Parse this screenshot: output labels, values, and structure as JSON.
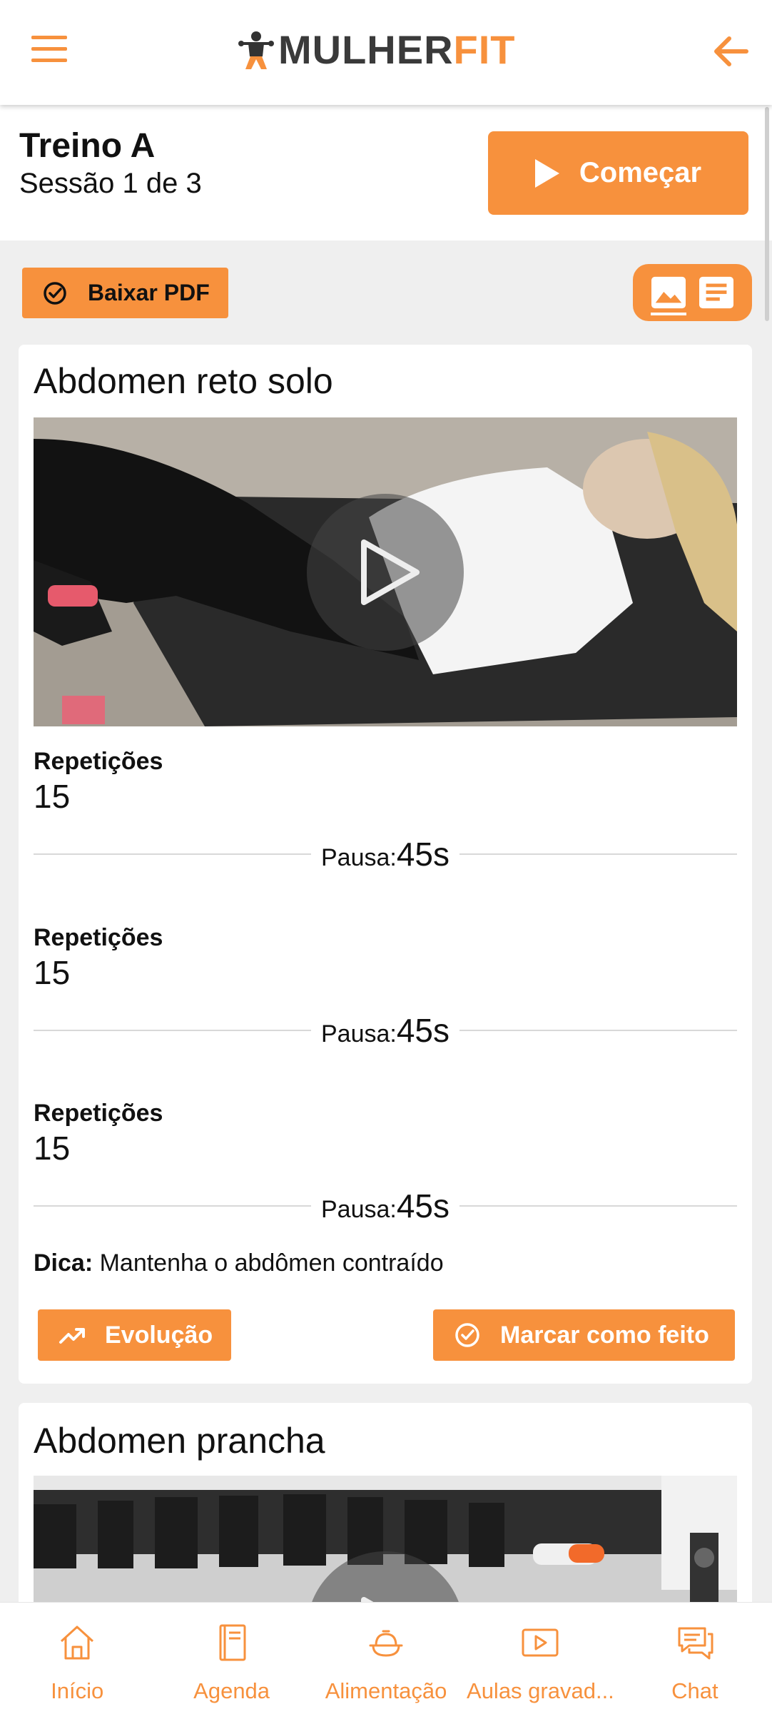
{
  "header": {
    "logo_part1": "MULHER",
    "logo_part2": "FIT",
    "menu_icon": "hamburger-menu-icon",
    "back_icon": "arrow-left-icon"
  },
  "session": {
    "title": "Treino A",
    "subtitle": "Sessão 1 de 3",
    "start_label": "Começar"
  },
  "toolbar": {
    "pdf_label": "Baixar PDF",
    "view_options": [
      "image-view-icon",
      "text-view-icon"
    ]
  },
  "exercises": [
    {
      "name": "Abdomen reto solo",
      "sets": [
        {
          "label": "Repetições",
          "value": "15",
          "pause_label": "Pausa:",
          "pause_value": "45s"
        },
        {
          "label": "Repetições",
          "value": "15",
          "pause_label": "Pausa:",
          "pause_value": "45s"
        },
        {
          "label": "Repetições",
          "value": "15",
          "pause_label": "Pausa:",
          "pause_value": "45s"
        }
      ],
      "tip_label": "Dica:",
      "tip_text": " Mantenha o abdômen contraído",
      "evolution_label": "Evolução",
      "done_label": "Marcar como feito"
    },
    {
      "name": "Abdomen prancha"
    }
  ],
  "bottom_nav": [
    {
      "label": "Início",
      "icon": "home-icon"
    },
    {
      "label": "Agenda",
      "icon": "notebook-icon"
    },
    {
      "label": "Alimentação",
      "icon": "meal-icon"
    },
    {
      "label": "Aulas gravad...",
      "icon": "video-play-icon"
    },
    {
      "label": "Chat",
      "icon": "chat-icon"
    }
  ],
  "colors": {
    "accent": "#f7913d",
    "text": "#111111",
    "background": "#efefef"
  }
}
